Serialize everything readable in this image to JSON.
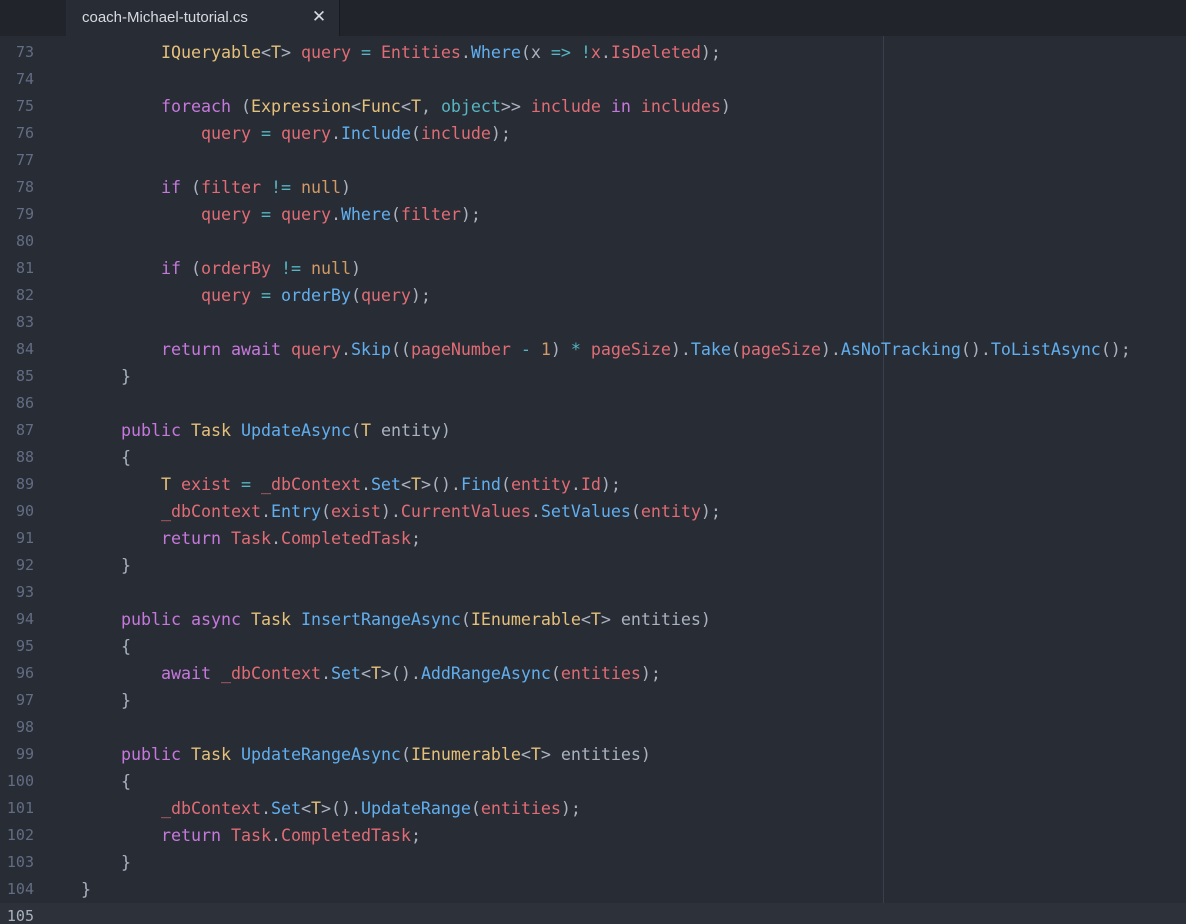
{
  "tab": {
    "title": "coach-Michael-tutorial.cs",
    "close_glyph": "✕"
  },
  "colors": {
    "background": "#282c34",
    "tab_bar": "#21252b",
    "keyword": "#c678dd",
    "type": "#e5c07b",
    "function": "#61afef",
    "variable": "#e06c75",
    "operator": "#56b6c2",
    "number": "#d19a66",
    "plain": "#abb2bf",
    "gutter": "#636d83"
  },
  "editor": {
    "cursor_line": 105,
    "lines": [
      {
        "n": "73",
        "tokens": [
          [
            "",
            "        "
          ],
          [
            "type",
            "IQueryable"
          ],
          [
            "plain",
            "<"
          ],
          [
            "type",
            "T"
          ],
          [
            "plain",
            "> "
          ],
          [
            "var",
            "query"
          ],
          [
            "plain",
            " "
          ],
          [
            "op",
            "="
          ],
          [
            "plain",
            " "
          ],
          [
            "var",
            "Entities"
          ],
          [
            "plain",
            "."
          ],
          [
            "fn",
            "Where"
          ],
          [
            "plain",
            "(x "
          ],
          [
            "op",
            "=>"
          ],
          [
            "plain",
            " "
          ],
          [
            "op",
            "!"
          ],
          [
            "var",
            "x"
          ],
          [
            "plain",
            "."
          ],
          [
            "var",
            "IsDeleted"
          ],
          [
            "plain",
            ");"
          ]
        ]
      },
      {
        "n": "74",
        "tokens": []
      },
      {
        "n": "75",
        "tokens": [
          [
            "",
            "        "
          ],
          [
            "kw",
            "foreach"
          ],
          [
            "plain",
            " ("
          ],
          [
            "type",
            "Expression"
          ],
          [
            "plain",
            "<"
          ],
          [
            "type",
            "Func"
          ],
          [
            "plain",
            "<"
          ],
          [
            "type",
            "T"
          ],
          [
            "plain",
            ", "
          ],
          [
            "op",
            "object"
          ],
          [
            "plain",
            ">> "
          ],
          [
            "var",
            "include"
          ],
          [
            "plain",
            " "
          ],
          [
            "kw",
            "in"
          ],
          [
            "plain",
            " "
          ],
          [
            "var",
            "includes"
          ],
          [
            "plain",
            ")"
          ]
        ]
      },
      {
        "n": "76",
        "tokens": [
          [
            "",
            "            "
          ],
          [
            "var",
            "query"
          ],
          [
            "plain",
            " "
          ],
          [
            "op",
            "="
          ],
          [
            "plain",
            " "
          ],
          [
            "var",
            "query"
          ],
          [
            "plain",
            "."
          ],
          [
            "fn",
            "Include"
          ],
          [
            "plain",
            "("
          ],
          [
            "var",
            "include"
          ],
          [
            "plain",
            ");"
          ]
        ]
      },
      {
        "n": "77",
        "tokens": []
      },
      {
        "n": "78",
        "tokens": [
          [
            "",
            "        "
          ],
          [
            "kw",
            "if"
          ],
          [
            "plain",
            " ("
          ],
          [
            "var",
            "filter"
          ],
          [
            "plain",
            " "
          ],
          [
            "op",
            "!="
          ],
          [
            "plain",
            " "
          ],
          [
            "num",
            "null"
          ],
          [
            "plain",
            ")"
          ]
        ]
      },
      {
        "n": "79",
        "tokens": [
          [
            "",
            "            "
          ],
          [
            "var",
            "query"
          ],
          [
            "plain",
            " "
          ],
          [
            "op",
            "="
          ],
          [
            "plain",
            " "
          ],
          [
            "var",
            "query"
          ],
          [
            "plain",
            "."
          ],
          [
            "fn",
            "Where"
          ],
          [
            "plain",
            "("
          ],
          [
            "var",
            "filter"
          ],
          [
            "plain",
            ");"
          ]
        ]
      },
      {
        "n": "80",
        "tokens": []
      },
      {
        "n": "81",
        "tokens": [
          [
            "",
            "        "
          ],
          [
            "kw",
            "if"
          ],
          [
            "plain",
            " ("
          ],
          [
            "var",
            "orderBy"
          ],
          [
            "plain",
            " "
          ],
          [
            "op",
            "!="
          ],
          [
            "plain",
            " "
          ],
          [
            "num",
            "null"
          ],
          [
            "plain",
            ")"
          ]
        ]
      },
      {
        "n": "82",
        "tokens": [
          [
            "",
            "            "
          ],
          [
            "var",
            "query"
          ],
          [
            "plain",
            " "
          ],
          [
            "op",
            "="
          ],
          [
            "plain",
            " "
          ],
          [
            "fn",
            "orderBy"
          ],
          [
            "plain",
            "("
          ],
          [
            "var",
            "query"
          ],
          [
            "plain",
            ");"
          ]
        ]
      },
      {
        "n": "83",
        "tokens": []
      },
      {
        "n": "84",
        "tokens": [
          [
            "",
            "        "
          ],
          [
            "kw",
            "return"
          ],
          [
            "plain",
            " "
          ],
          [
            "kw",
            "await"
          ],
          [
            "plain",
            " "
          ],
          [
            "var",
            "query"
          ],
          [
            "plain",
            "."
          ],
          [
            "fn",
            "Skip"
          ],
          [
            "plain",
            "(("
          ],
          [
            "var",
            "pageNumber"
          ],
          [
            "plain",
            " "
          ],
          [
            "op",
            "-"
          ],
          [
            "plain",
            " "
          ],
          [
            "num",
            "1"
          ],
          [
            "plain",
            ") "
          ],
          [
            "op",
            "*"
          ],
          [
            "plain",
            " "
          ],
          [
            "var",
            "pageSize"
          ],
          [
            "plain",
            ")."
          ],
          [
            "fn",
            "Take"
          ],
          [
            "plain",
            "("
          ],
          [
            "var",
            "pageSize"
          ],
          [
            "plain",
            ")."
          ],
          [
            "fn",
            "AsNoTracking"
          ],
          [
            "plain",
            "()."
          ],
          [
            "fn",
            "ToListAsync"
          ],
          [
            "plain",
            "();"
          ]
        ]
      },
      {
        "n": "85",
        "tokens": [
          [
            "",
            "    "
          ],
          [
            "plain",
            "}"
          ]
        ]
      },
      {
        "n": "86",
        "tokens": []
      },
      {
        "n": "87",
        "tokens": [
          [
            "",
            "    "
          ],
          [
            "kw",
            "public"
          ],
          [
            "plain",
            " "
          ],
          [
            "type",
            "Task"
          ],
          [
            "plain",
            " "
          ],
          [
            "fn",
            "UpdateAsync"
          ],
          [
            "plain",
            "("
          ],
          [
            "type",
            "T"
          ],
          [
            "plain",
            " entity)"
          ]
        ]
      },
      {
        "n": "88",
        "tokens": [
          [
            "",
            "    "
          ],
          [
            "plain",
            "{"
          ]
        ]
      },
      {
        "n": "89",
        "tokens": [
          [
            "",
            "        "
          ],
          [
            "type",
            "T"
          ],
          [
            "plain",
            " "
          ],
          [
            "var",
            "exist"
          ],
          [
            "plain",
            " "
          ],
          [
            "op",
            "="
          ],
          [
            "plain",
            " "
          ],
          [
            "var",
            "_dbContext"
          ],
          [
            "plain",
            "."
          ],
          [
            "fn",
            "Set"
          ],
          [
            "plain",
            "<"
          ],
          [
            "type",
            "T"
          ],
          [
            "plain",
            ">()."
          ],
          [
            "fn",
            "Find"
          ],
          [
            "plain",
            "("
          ],
          [
            "var",
            "entity"
          ],
          [
            "plain",
            "."
          ],
          [
            "var",
            "Id"
          ],
          [
            "plain",
            ");"
          ]
        ]
      },
      {
        "n": "90",
        "tokens": [
          [
            "",
            "        "
          ],
          [
            "var",
            "_dbContext"
          ],
          [
            "plain",
            "."
          ],
          [
            "fn",
            "Entry"
          ],
          [
            "plain",
            "("
          ],
          [
            "var",
            "exist"
          ],
          [
            "plain",
            ")."
          ],
          [
            "var",
            "CurrentValues"
          ],
          [
            "plain",
            "."
          ],
          [
            "fn",
            "SetValues"
          ],
          [
            "plain",
            "("
          ],
          [
            "var",
            "entity"
          ],
          [
            "plain",
            ");"
          ]
        ]
      },
      {
        "n": "91",
        "tokens": [
          [
            "",
            "        "
          ],
          [
            "kw",
            "return"
          ],
          [
            "plain",
            " "
          ],
          [
            "var",
            "Task"
          ],
          [
            "plain",
            "."
          ],
          [
            "var",
            "CompletedTask"
          ],
          [
            "plain",
            ";"
          ]
        ]
      },
      {
        "n": "92",
        "tokens": [
          [
            "",
            "    "
          ],
          [
            "plain",
            "}"
          ]
        ]
      },
      {
        "n": "93",
        "tokens": []
      },
      {
        "n": "94",
        "tokens": [
          [
            "",
            "    "
          ],
          [
            "kw",
            "public"
          ],
          [
            "plain",
            " "
          ],
          [
            "kw",
            "async"
          ],
          [
            "plain",
            " "
          ],
          [
            "type",
            "Task"
          ],
          [
            "plain",
            " "
          ],
          [
            "fn",
            "InsertRangeAsync"
          ],
          [
            "plain",
            "("
          ],
          [
            "type",
            "IEnumerable"
          ],
          [
            "plain",
            "<"
          ],
          [
            "type",
            "T"
          ],
          [
            "plain",
            "> entities)"
          ]
        ]
      },
      {
        "n": "95",
        "tokens": [
          [
            "",
            "    "
          ],
          [
            "plain",
            "{"
          ]
        ]
      },
      {
        "n": "96",
        "tokens": [
          [
            "",
            "        "
          ],
          [
            "kw",
            "await"
          ],
          [
            "plain",
            " "
          ],
          [
            "var",
            "_dbContext"
          ],
          [
            "plain",
            "."
          ],
          [
            "fn",
            "Set"
          ],
          [
            "plain",
            "<"
          ],
          [
            "type",
            "T"
          ],
          [
            "plain",
            ">()."
          ],
          [
            "fn",
            "AddRangeAsync"
          ],
          [
            "plain",
            "("
          ],
          [
            "var",
            "entities"
          ],
          [
            "plain",
            ");"
          ]
        ]
      },
      {
        "n": "97",
        "tokens": [
          [
            "",
            "    "
          ],
          [
            "plain",
            "}"
          ]
        ]
      },
      {
        "n": "98",
        "tokens": []
      },
      {
        "n": "99",
        "tokens": [
          [
            "",
            "    "
          ],
          [
            "kw",
            "public"
          ],
          [
            "plain",
            " "
          ],
          [
            "type",
            "Task"
          ],
          [
            "plain",
            " "
          ],
          [
            "fn",
            "UpdateRangeAsync"
          ],
          [
            "plain",
            "("
          ],
          [
            "type",
            "IEnumerable"
          ],
          [
            "plain",
            "<"
          ],
          [
            "type",
            "T"
          ],
          [
            "plain",
            "> entities)"
          ]
        ]
      },
      {
        "n": "100",
        "tokens": [
          [
            "",
            "    "
          ],
          [
            "plain",
            "{"
          ]
        ]
      },
      {
        "n": "101",
        "tokens": [
          [
            "",
            "        "
          ],
          [
            "var",
            "_dbContext"
          ],
          [
            "plain",
            "."
          ],
          [
            "fn",
            "Set"
          ],
          [
            "plain",
            "<"
          ],
          [
            "type",
            "T"
          ],
          [
            "plain",
            ">()."
          ],
          [
            "fn",
            "UpdateRange"
          ],
          [
            "plain",
            "("
          ],
          [
            "var",
            "entities"
          ],
          [
            "plain",
            ");"
          ]
        ]
      },
      {
        "n": "102",
        "tokens": [
          [
            "",
            "        "
          ],
          [
            "kw",
            "return"
          ],
          [
            "plain",
            " "
          ],
          [
            "var",
            "Task"
          ],
          [
            "plain",
            "."
          ],
          [
            "var",
            "CompletedTask"
          ],
          [
            "plain",
            ";"
          ]
        ]
      },
      {
        "n": "103",
        "tokens": [
          [
            "",
            "    "
          ],
          [
            "plain",
            "}"
          ]
        ]
      },
      {
        "n": "104",
        "tokens": [
          [
            "plain",
            "}"
          ]
        ]
      },
      {
        "n": "105",
        "tokens": []
      }
    ]
  }
}
